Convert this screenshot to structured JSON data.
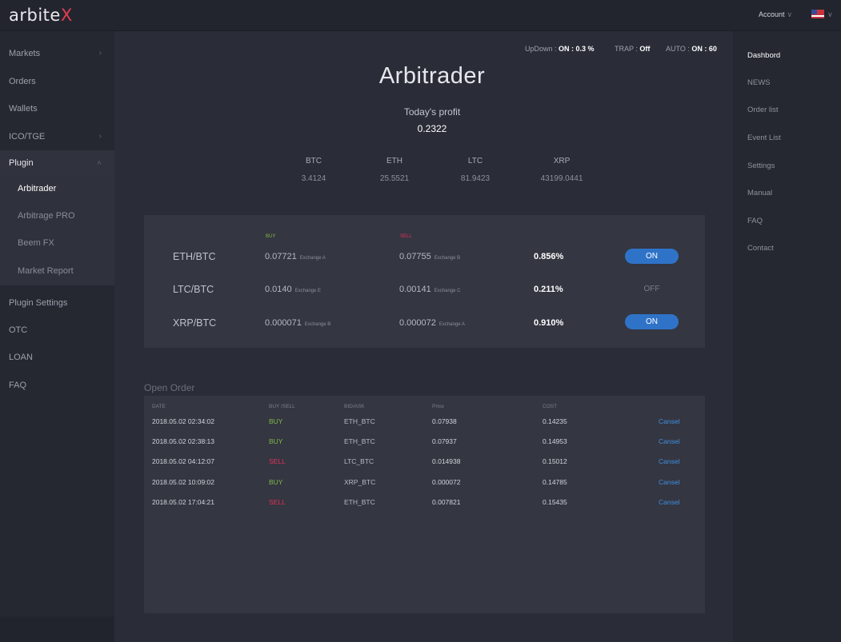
{
  "brand": {
    "name": "arbite",
    "name_accent": "X",
    "accent_color": "#e03e52"
  },
  "header": {
    "account_label": "Account",
    "chevron": "∨"
  },
  "left_nav": {
    "items": [
      {
        "label": "Markets",
        "arrow": "›"
      },
      {
        "label": "Orders",
        "arrow": ""
      },
      {
        "label": "Wallets",
        "arrow": ""
      },
      {
        "label": "ICO/TGE",
        "arrow": "›"
      },
      {
        "label": "Plugin",
        "arrow": "˄"
      }
    ],
    "plugin_sub": [
      "Arbitrader",
      "Arbitrage PRO",
      "Beem FX",
      "Market Report"
    ],
    "bottom_items": [
      "Plugin Settings",
      "OTC",
      "LOAN",
      "FAQ"
    ]
  },
  "right_nav": [
    "Dashbord",
    "NEWS",
    "Order list",
    "Event List",
    "Settings",
    "Manual",
    "FAQ",
    "Contact"
  ],
  "status_bar": {
    "updown_label": "UpDown : ",
    "updown_value": "ON : 0.3 %",
    "trap_label": "TRAP : ",
    "trap_value": "Off",
    "auto_label": "AUTO : ",
    "auto_value": "ON : 60"
  },
  "main": {
    "title": "Arbitrader",
    "profit_label": "Today's profit",
    "profit_value": "0.2322",
    "coins": [
      {
        "name": "BTC",
        "value": "3.4124"
      },
      {
        "name": "ETH",
        "value": "25.5521"
      },
      {
        "name": "LTC",
        "value": "81.9423"
      },
      {
        "name": "XRP",
        "value": "43199.0441"
      }
    ]
  },
  "arb_panel": {
    "buy_label": "BUY",
    "sell_label": "SELL",
    "buy_color": "#7fb848",
    "sell_color": "#e0325a",
    "rows": [
      {
        "pair": "ETH/BTC",
        "buy": "0.07721",
        "buy_ex": "Exchange A",
        "sell": "0.07755",
        "sell_ex": "Exchange B",
        "pct": "0.856%",
        "toggle": "ON"
      },
      {
        "pair": "LTC/BTC",
        "buy": "0.0140",
        "buy_ex": "Exchange E",
        "sell": "0.00141",
        "sell_ex": "Exchange C",
        "pct": "0.211%",
        "toggle": "OFF"
      },
      {
        "pair": "XRP/BTC",
        "buy": "0.000071",
        "buy_ex": "Exchange B",
        "sell": "0.000072",
        "sell_ex": "Exchange A",
        "pct": "0.910%",
        "toggle": "ON"
      }
    ]
  },
  "open_order": {
    "title": "Open Order",
    "headers": [
      "DATE",
      "BUY /SELL",
      "BID/ASK",
      "Price",
      "COST"
    ],
    "rows": [
      {
        "date": "2018.05.02  02:34:02",
        "side": "BUY",
        "pair": "ETH_BTC",
        "price": "0.07938",
        "cost": "0.14235",
        "action": "Cansel"
      },
      {
        "date": "2018.05.02  02:38:13",
        "side": "BUY",
        "pair": "ETH_BTC",
        "price": "0.07937",
        "cost": "0.14953",
        "action": "Cansel"
      },
      {
        "date": "2018.05.02  04:12:07",
        "side": "SELL",
        "pair": "LTC_BTC",
        "price": "0.014938",
        "cost": "0.15012",
        "action": "Cansel"
      },
      {
        "date": "2018.05.02  10:09:02",
        "side": "BUY",
        "pair": "XRP_BTC",
        "price": "0.000072",
        "cost": "0.14785",
        "action": "Cansel"
      },
      {
        "date": "2018.05.02  17:04:21",
        "side": "SELL",
        "pair": "ETH_BTC",
        "price": "0.007821",
        "cost": "0.15435",
        "action": "Cansel"
      }
    ]
  }
}
